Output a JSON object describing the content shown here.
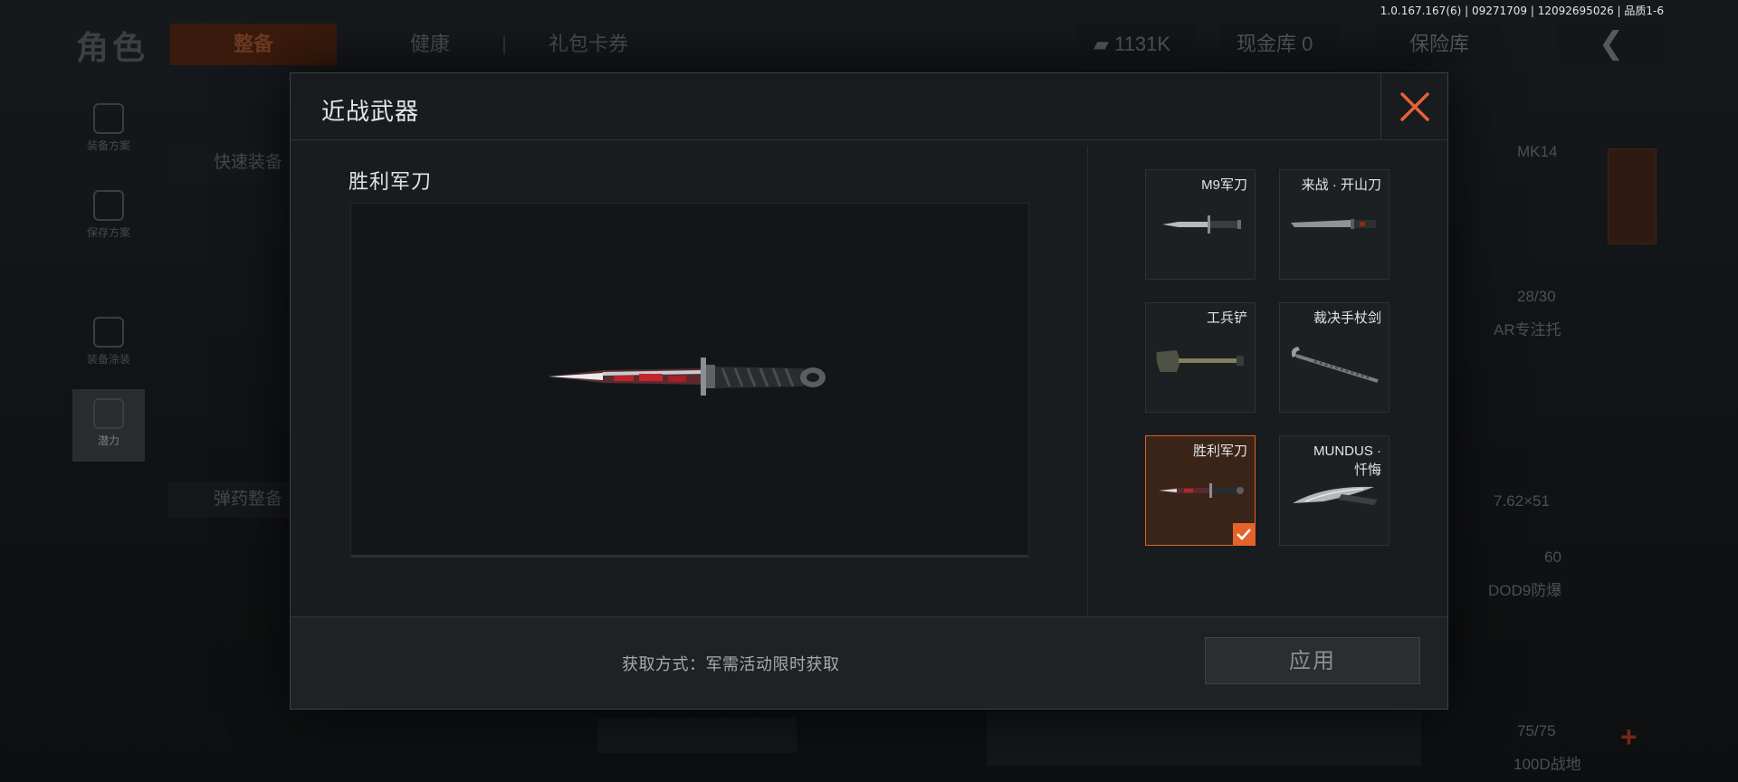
{
  "version_info": "1.0.167.167(6) | 09271709 | 12092695026 | 品质1-6",
  "background": {
    "title": "角色",
    "tabs": [
      {
        "label": "整备",
        "active": true
      },
      {
        "label": "健康",
        "active": false
      },
      {
        "label": "礼包卡券",
        "active": false
      }
    ],
    "currency": "1131K",
    "vault": "现金库 0",
    "insurance": "保险库",
    "back_icon": "chevron-left-icon",
    "sidebar": [
      {
        "label": "装备方案",
        "icon": "vest-icon"
      },
      {
        "label": "保存方案",
        "icon": "download-icon"
      },
      {
        "label": "装备涂装",
        "icon": "helmet-icon"
      },
      {
        "label": "潜力",
        "icon": "lightning-shield-icon"
      }
    ],
    "quick_equip": "快速装备",
    "ammo_equip": "弹药整备",
    "right_labels": {
      "weapon": "MK14",
      "ammo_count": "28/30",
      "attachment": "AR专注托",
      "ammo_type": "7.62×51",
      "ammo_qty": "60",
      "armor": "DOD9防爆",
      "durability": "75/75",
      "helmet": "100D战地"
    }
  },
  "modal": {
    "title": "近战武器",
    "close_icon": "close-icon",
    "selected_name": "胜利军刀",
    "items": [
      {
        "name": "M9军刀",
        "icon": "knife-icon",
        "selected": false
      },
      {
        "name": "来战 · 开山刀",
        "icon": "machete-icon",
        "selected": false
      },
      {
        "name": "工兵铲",
        "icon": "shovel-icon",
        "selected": false
      },
      {
        "name": "裁决手杖剑",
        "icon": "cane-sword-icon",
        "selected": false
      },
      {
        "name": "胜利军刀",
        "icon": "red-knife-icon",
        "selected": true
      },
      {
        "name_line1": "MUNDUS ·",
        "name_line2": "忏悔",
        "icon": "karambit-icon",
        "selected": false
      }
    ],
    "acquire_text": "获取方式：军需活动限时获取",
    "apply_label": "应用",
    "accent_color": "#e3632a"
  }
}
